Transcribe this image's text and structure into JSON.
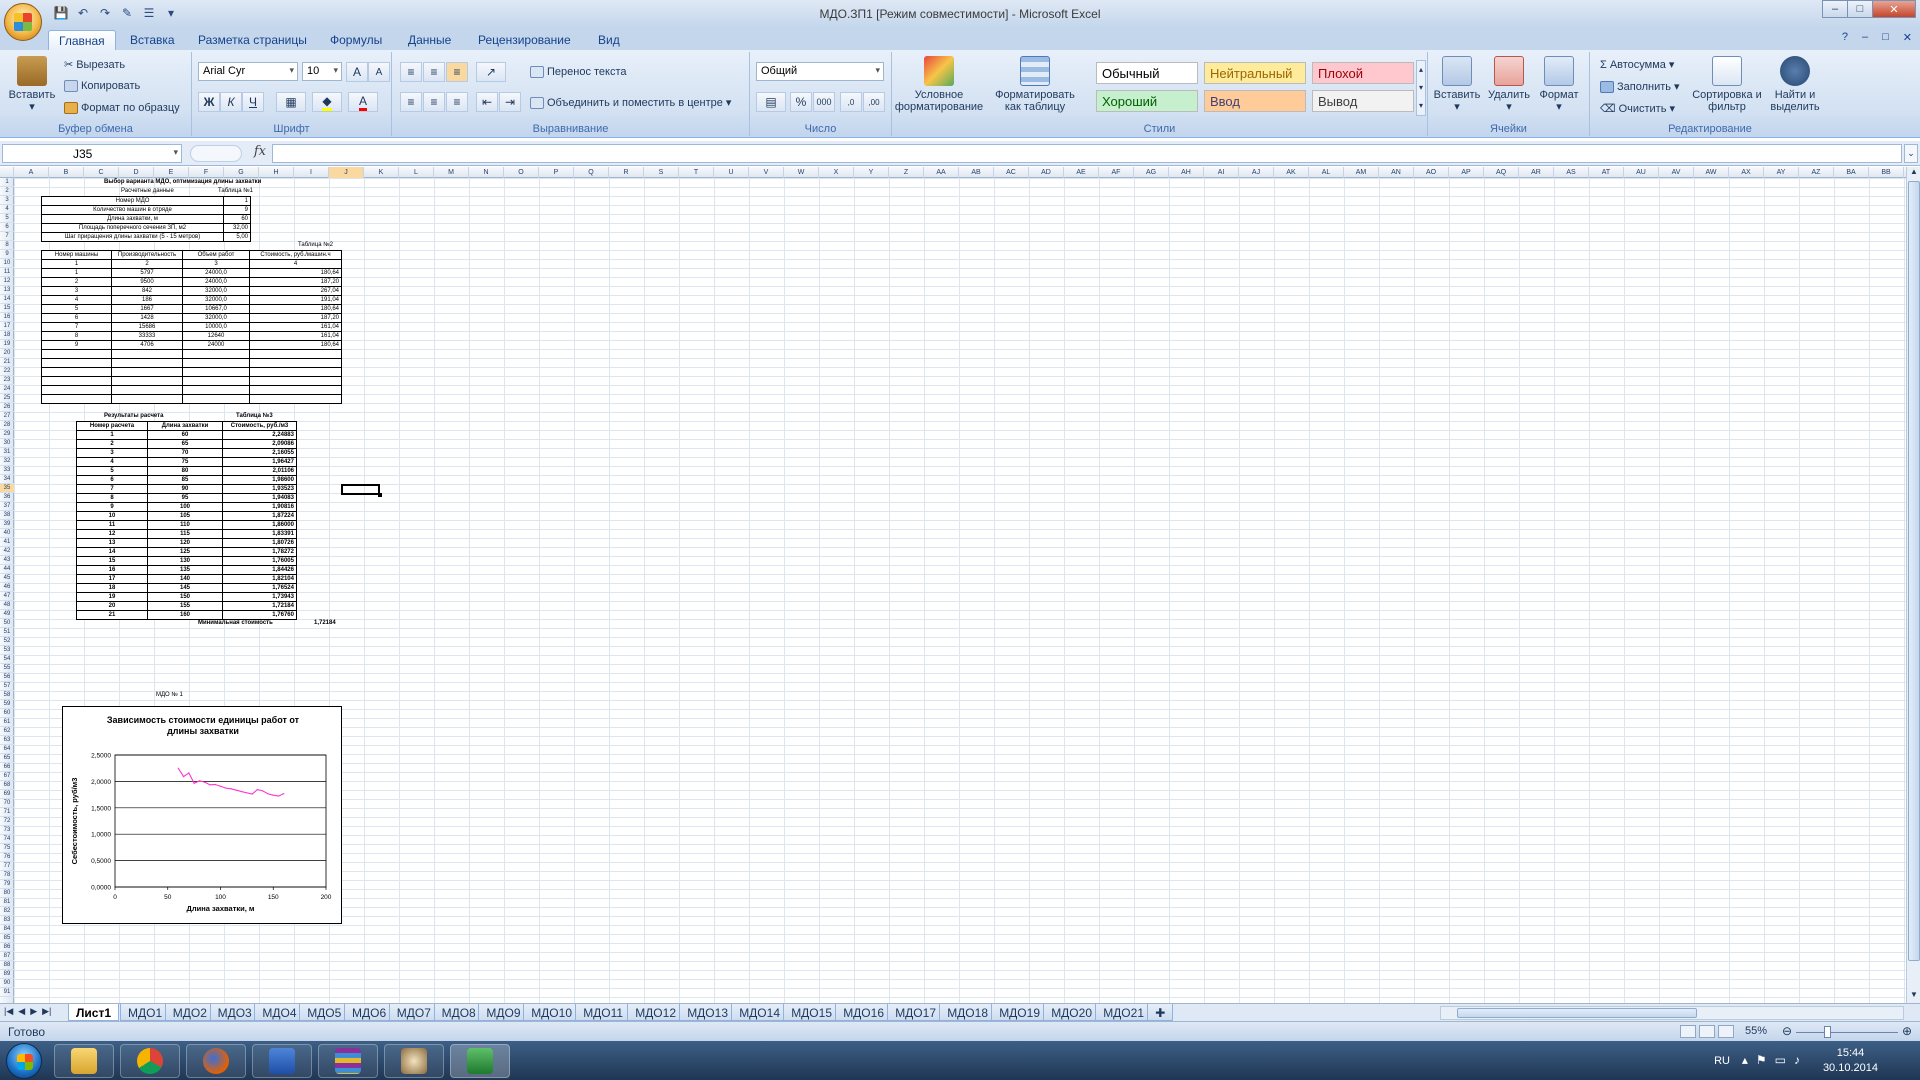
{
  "window": {
    "title": "МДО.ЗП1  [Режим совместимости] - Microsoft Excel",
    "controls": [
      "–",
      "□",
      "✕"
    ]
  },
  "ribbon_tabs": [
    "Главная",
    "Вставка",
    "Разметка страницы",
    "Формулы",
    "Данные",
    "Рецензирование",
    "Вид"
  ],
  "ribbon": {
    "clipboard": {
      "label": "Буфер обмена",
      "paste": "Вставить",
      "cut": "Вырезать",
      "copy": "Копировать",
      "format_painter": "Формат по образцу"
    },
    "font": {
      "label": "Шрифт",
      "name": "Arial Cyr",
      "size": "10",
      "bold": "Ж",
      "italic": "К",
      "underline": "Ч"
    },
    "alignment": {
      "label": "Выравнивание",
      "wrap": "Перенос текста",
      "merge": "Объединить и поместить в центре"
    },
    "number": {
      "label": "Число",
      "format": "Общий",
      "percent": "%",
      "thousands": "000"
    },
    "styles": {
      "label": "Стили",
      "conditional": "Условное форматирование",
      "as_table": "Форматировать как таблицу",
      "cells": [
        {
          "name": "Обычный",
          "bg": "#ffffff",
          "fg": "#000000"
        },
        {
          "name": "Нейтральный",
          "bg": "#ffeb9c",
          "fg": "#9c6500"
        },
        {
          "name": "Плохой",
          "bg": "#ffc7ce",
          "fg": "#9c0006"
        },
        {
          "name": "Хороший",
          "bg": "#c6efce",
          "fg": "#006100"
        },
        {
          "name": "Ввод",
          "bg": "#ffcc99",
          "fg": "#3f3f76"
        },
        {
          "name": "Вывод",
          "bg": "#f2f2f2",
          "fg": "#3f3f3f"
        }
      ]
    },
    "cells": {
      "label": "Ячейки",
      "insert": "Вставить",
      "delete": "Удалить",
      "format": "Формат"
    },
    "editing": {
      "label": "Редактирование",
      "autosum": "Автосумма",
      "fill": "Заполнить",
      "clear": "Очистить",
      "sort": "Сортировка и фильтр",
      "find": "Найти и выделить"
    }
  },
  "formula_bar": {
    "name_box": "J35",
    "fx": "fx",
    "value": ""
  },
  "columns": [
    "A",
    "B",
    "C",
    "D",
    "E",
    "F",
    "G",
    "H",
    "I",
    "J",
    "K",
    "L",
    "M",
    "N",
    "O",
    "P",
    "Q",
    "R",
    "S",
    "T",
    "U",
    "V",
    "W",
    "X",
    "Y",
    "Z",
    "AA",
    "AB",
    "AC",
    "AD",
    "AE",
    "AF",
    "AG",
    "AH",
    "AI",
    "AJ",
    "AK",
    "AL",
    "AM",
    "AN",
    "AO",
    "AP",
    "AQ",
    "AR",
    "AS",
    "AT",
    "AU",
    "AV",
    "AW",
    "AX",
    "AY",
    "AZ",
    "BA",
    "BB"
  ],
  "selected_column": "J",
  "selected_row": 35,
  "sheet": {
    "title1": "Выбор варианта МДО, оптимизация длины захватки",
    "calc_data_label": "Расчетные данные",
    "table1_label": "Таблица №1",
    "table1": [
      [
        "Номер МДО",
        "1"
      ],
      [
        "Количество машин в отряде",
        "9"
      ],
      [
        "Длина захватки, м",
        "60"
      ],
      [
        "Площадь поперечного сечения ЗП, м2",
        "32,00"
      ],
      [
        "Шаг приращения длины захватки (5 - 15 метров)",
        "5,00"
      ]
    ],
    "table2_label": "Таблица №2",
    "table2_headers": [
      "Номер машины",
      "Производительность",
      "Объем работ",
      "Стоимость, руб./машин.ч"
    ],
    "table2_nums": [
      "1",
      "2",
      "3",
      "4"
    ],
    "table2_rows": [
      [
        "1",
        "5797",
        "24000,0",
        "180,64"
      ],
      [
        "2",
        "9500",
        "24000,0",
        "187,20"
      ],
      [
        "3",
        "842",
        "32000,0",
        "267,04"
      ],
      [
        "4",
        "186",
        "32000,0",
        "191,04"
      ],
      [
        "5",
        "1667",
        "10667,0",
        "180,64"
      ],
      [
        "6",
        "1428",
        "32000,0",
        "187,20"
      ],
      [
        "7",
        "15686",
        "10000,0",
        "161,04"
      ],
      [
        "8",
        "33333",
        "12640",
        "161,04"
      ],
      [
        "9",
        "4706",
        "24000",
        "180,64"
      ]
    ],
    "results_label": "Результаты расчета",
    "table3_label": "Таблица №3",
    "table3_headers": [
      "Номер расчета",
      "Длина захватки",
      "Стоимость, руб./м3"
    ],
    "table3_rows": [
      [
        "1",
        "60",
        "2,24883"
      ],
      [
        "2",
        "65",
        "2,09086"
      ],
      [
        "3",
        "70",
        "2,16055"
      ],
      [
        "4",
        "75",
        "1,96427"
      ],
      [
        "5",
        "80",
        "2,01106"
      ],
      [
        "6",
        "85",
        "1,98600"
      ],
      [
        "7",
        "90",
        "1,93523"
      ],
      [
        "8",
        "95",
        "1,94083"
      ],
      [
        "9",
        "100",
        "1,90816"
      ],
      [
        "10",
        "105",
        "1,87224"
      ],
      [
        "11",
        "110",
        "1,86000"
      ],
      [
        "12",
        "115",
        "1,83391"
      ],
      [
        "13",
        "120",
        "1,80726"
      ],
      [
        "14",
        "125",
        "1,78272"
      ],
      [
        "15",
        "130",
        "1,76005"
      ],
      [
        "16",
        "135",
        "1,84426"
      ],
      [
        "17",
        "140",
        "1,82104"
      ],
      [
        "18",
        "145",
        "1,76524"
      ],
      [
        "19",
        "150",
        "1,73943"
      ],
      [
        "20",
        "155",
        "1,72184"
      ],
      [
        "21",
        "160",
        "1,76760"
      ]
    ],
    "min_label": "Минимальная стоимость",
    "min_value": "1,72184",
    "chart_caption": "МДО № 1"
  },
  "chart_data": {
    "type": "line",
    "title": "Зависимость стоимости единицы работ от длины захватки",
    "xlabel": "Длина захватки, м",
    "ylabel": "Себестоимость, руб/м3",
    "x": [
      60,
      65,
      70,
      75,
      80,
      85,
      90,
      95,
      100,
      105,
      110,
      115,
      120,
      125,
      130,
      135,
      140,
      145,
      150,
      155,
      160
    ],
    "series": [
      {
        "values": [
          2.24883,
          2.09086,
          2.16055,
          1.96427,
          2.01106,
          1.986,
          1.93523,
          1.94083,
          1.90816,
          1.87224,
          1.86,
          1.83391,
          1.80726,
          1.78272,
          1.76005,
          1.84426,
          1.82104,
          1.76524,
          1.73943,
          1.72184,
          1.7676
        ],
        "color": "#ff33cc"
      }
    ],
    "xlim": [
      0,
      200
    ],
    "ylim": [
      0,
      2.5
    ],
    "xticks": [
      "0",
      "50",
      "100",
      "150",
      "200"
    ],
    "yticks": [
      "0,0000",
      "0,5000",
      "1,0000",
      "1,5000",
      "2,0000",
      "2,5000"
    ],
    "grid": true
  },
  "sheet_tabs": [
    "Лист1",
    "МДО1",
    "МДО2",
    "МДО3",
    "МДО4",
    "МДО5",
    "МДО6",
    "МДО7",
    "МДО8",
    "МДО9",
    "МДО10",
    "МДО11",
    "МДО12",
    "МДО13",
    "МДО14",
    "МДО15",
    "МДО16",
    "МДО17",
    "МДО18",
    "МДО19",
    "МДО20",
    "МДО21"
  ],
  "status": {
    "ready": "Готово",
    "zoom": "55%"
  },
  "taskbar": {
    "lang": "RU",
    "time": "15:44",
    "date": "30.10.2014"
  }
}
